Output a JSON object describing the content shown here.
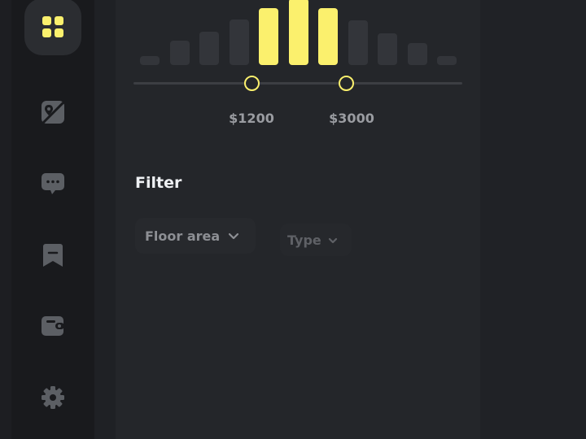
{
  "sidebar": {
    "items": [
      {
        "icon": "grid-icon",
        "active": true
      },
      {
        "icon": "map-icon"
      },
      {
        "icon": "chat-icon"
      },
      {
        "icon": "bookmark-icon"
      },
      {
        "icon": "wallet-icon"
      },
      {
        "icon": "gear-icon"
      }
    ]
  },
  "price_range": {
    "min_label": "$1200",
    "max_label": "$3000",
    "accent_color": "#fbf06d",
    "histogram_levels": [
      0.14,
      0.37,
      0.5,
      0.68,
      0.85,
      1.0,
      0.85,
      0.67,
      0.47,
      0.33,
      0.13
    ],
    "selected_bins": [
      4,
      5,
      6
    ]
  },
  "filter": {
    "title": "Filter",
    "dropdowns": [
      {
        "label": "Floor area"
      },
      {
        "label": "Type"
      }
    ]
  }
}
